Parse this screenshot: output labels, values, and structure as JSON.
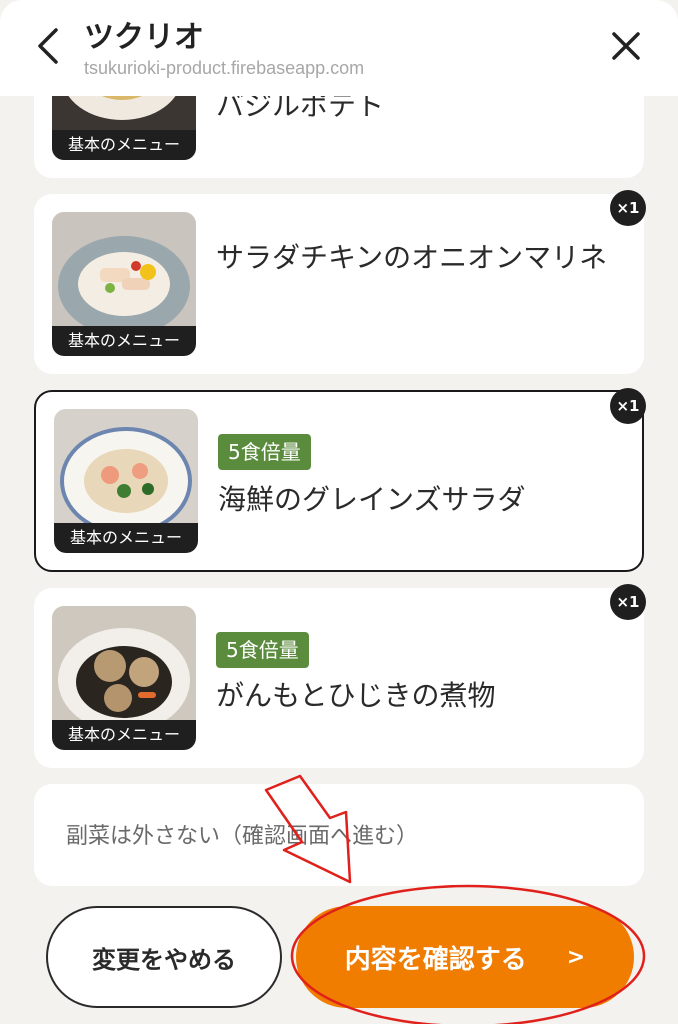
{
  "header": {
    "title": "ツクリオ",
    "url": "tsukurioki-product.firebaseapp.com"
  },
  "menu_items": [
    {
      "name": "バジルポテト",
      "tag": "",
      "thumb_caption": "基本のメニュー",
      "quantity": ""
    },
    {
      "name": "サラダチキンのオニオンマリネ",
      "tag": "",
      "thumb_caption": "基本のメニュー",
      "quantity": "×1"
    },
    {
      "name": "海鮮のグレインズサラダ",
      "tag": "5食倍量",
      "thumb_caption": "基本のメニュー",
      "quantity": "×1"
    },
    {
      "name": "がんもとひじきの煮物",
      "tag": "5食倍量",
      "thumb_caption": "基本のメニュー",
      "quantity": "×1"
    }
  ],
  "skip_option": {
    "label": "副菜は外さない（確認画面へ進む）"
  },
  "buttons": {
    "cancel": "変更をやめる",
    "confirm": "内容を確認する",
    "confirm_chevron": ">"
  },
  "colors": {
    "accent": "#f07c00",
    "tag_green": "#5b8c3e",
    "annotation_red": "#e0201b"
  }
}
